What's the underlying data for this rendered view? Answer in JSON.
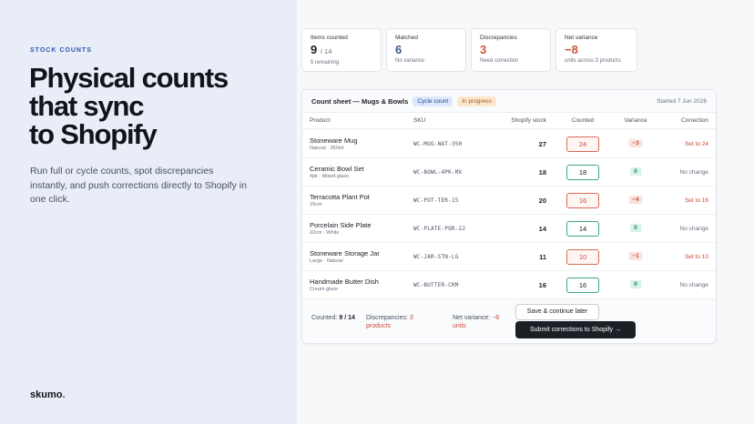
{
  "hero": {
    "eyebrow": "STOCK COUNTS",
    "headline_lines": [
      "Physical counts",
      "that sync",
      "to Shopify"
    ],
    "subtitle": "Run full or cycle counts, spot discrepancies instantly, and push corrections directly to Shopify in one click.",
    "brand": "skumo",
    "brand_dot": ".",
    "accent_color": "#2e54b4"
  },
  "stats": [
    {
      "label": "Items counted",
      "value": "9",
      "suffix": "/ 14",
      "note": "5 remaining",
      "color": "#1b1d24"
    },
    {
      "label": "Matched",
      "value": "6",
      "suffix": "",
      "note": "No variance",
      "color": "#3c5a86"
    },
    {
      "label": "Discrepancies",
      "value": "3",
      "suffix": "",
      "note": "Need correction",
      "color": "#d0553e"
    },
    {
      "label": "Net variance",
      "value": "−8",
      "suffix": "",
      "note": "units across 3 products",
      "color": "#d0553e"
    }
  ],
  "sheet": {
    "title": "Count sheet — Mugs & Bowls",
    "badge_type": "Cycle count",
    "badge_status": "In progress",
    "started": "Started 7 Jun 2026",
    "columns": [
      "Product",
      "SKU",
      "Shopify stock",
      "Counted",
      "Variance",
      "Correction"
    ],
    "rows": [
      {
        "name": "Stoneware Mug",
        "meta": "Natural · 350ml",
        "sku": "WC-MUG-NAT-350",
        "stock": "27",
        "counted": "24",
        "variance": "−3",
        "correction": "Set to 24",
        "status": "bad"
      },
      {
        "name": "Ceramic Bowl Set",
        "meta": "4pk · Mixed glaze",
        "sku": "WC-BOWL-4PK-MX",
        "stock": "18",
        "counted": "18",
        "variance": "0",
        "correction": "No change",
        "status": "ok"
      },
      {
        "name": "Terracotta Plant Pot",
        "meta": "15cm",
        "sku": "WC-POT-TER-15",
        "stock": "20",
        "counted": "16",
        "variance": "−4",
        "correction": "Set to 16",
        "status": "bad"
      },
      {
        "name": "Porcelain Side Plate",
        "meta": "22cm · White",
        "sku": "WC-PLATE-POR-22",
        "stock": "14",
        "counted": "14",
        "variance": "0",
        "correction": "No change",
        "status": "ok"
      },
      {
        "name": "Stoneware Storage Jar",
        "meta": "Large · Natural",
        "sku": "WC-JAR-STN-LG",
        "stock": "11",
        "counted": "10",
        "variance": "−1",
        "correction": "Set to 10",
        "status": "bad"
      },
      {
        "name": "Handmade Butter Dish",
        "meta": "Cream glaze",
        "sku": "WC-BUTTER-CRM",
        "stock": "16",
        "counted": "16",
        "variance": "0",
        "correction": "No change",
        "status": "ok"
      }
    ],
    "footer": {
      "counted_label": "Counted:",
      "counted_value": "9 / 14",
      "disc_label": "Discrepancies:",
      "disc_value": "3 products",
      "net_label": "Net variance:",
      "net_value": "−8 units",
      "save_button": "Save & continue later",
      "submit_button": "Submit corrections to Shopify →"
    }
  }
}
